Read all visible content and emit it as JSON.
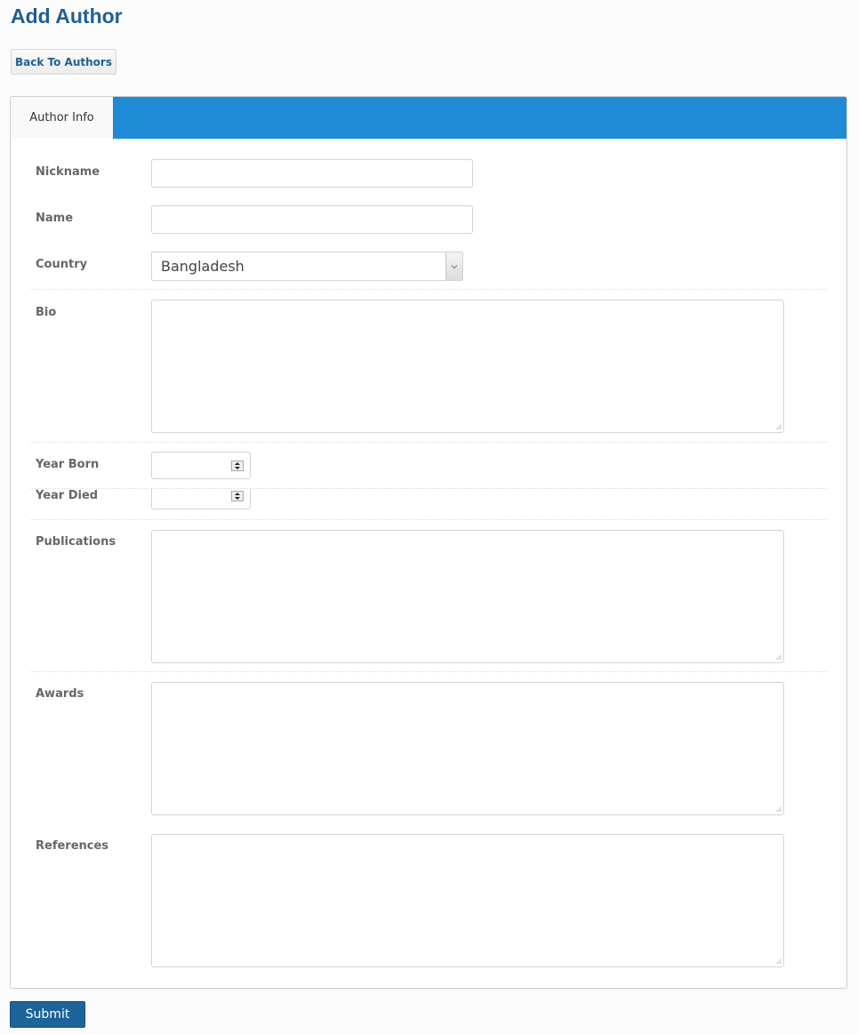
{
  "header": {
    "title": "Add Author",
    "back_label": "Back To Authors"
  },
  "tabs": [
    {
      "label": "Author Info",
      "active": true
    }
  ],
  "form": {
    "nickname": {
      "label": "Nickname",
      "value": ""
    },
    "name": {
      "label": "Name",
      "value": ""
    },
    "country": {
      "label": "Country",
      "selected": "Bangladesh"
    },
    "bio": {
      "label": "Bio",
      "value": ""
    },
    "year_born": {
      "label": "Year Born",
      "value": ""
    },
    "year_died": {
      "label": "Year Died",
      "value": ""
    },
    "publications": {
      "label": "Publications",
      "value": ""
    },
    "awards": {
      "label": "Awards",
      "value": ""
    },
    "references": {
      "label": "References",
      "value": ""
    }
  },
  "submit_label": "Submit",
  "colors": {
    "title": "#1e5f94",
    "tabbar": "#1f8bd6",
    "submit": "#1c6499"
  }
}
